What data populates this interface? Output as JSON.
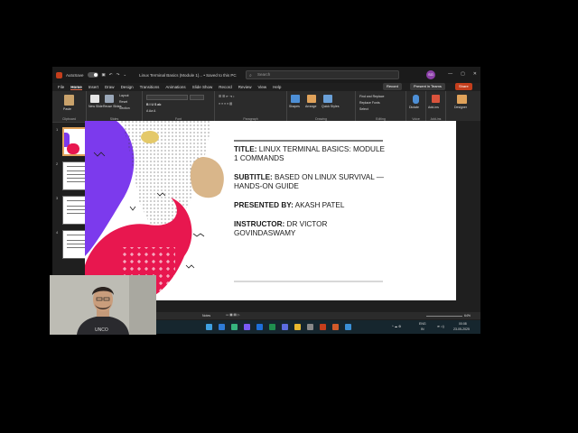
{
  "titlebar": {
    "autosave_label": "AutoSave",
    "autosave_state": "Off",
    "doc_title": "Linux Terminal Basics (Module 1)... • Saved to this PC",
    "search_placeholder": "Search",
    "user_initials": "SG",
    "controls": [
      "—",
      "▢",
      "✕"
    ]
  },
  "menu": {
    "tabs": [
      "File",
      "Home",
      "Insert",
      "Draw",
      "Design",
      "Transitions",
      "Animations",
      "Slide Show",
      "Record",
      "Review",
      "View",
      "Help"
    ],
    "active": "Home",
    "record_label": "Record",
    "teams_label": "Present in Teams",
    "share_label": "Share"
  },
  "ribbon": {
    "clipboard": {
      "paste": "Paste",
      "group": "Clipboard"
    },
    "slides": {
      "new_slide": "New Slide",
      "reuse": "Reuse Slides",
      "layout": "Layout",
      "reset": "Reset",
      "section": "Section",
      "group": "Slides"
    },
    "font": {
      "group": "Font"
    },
    "paragraph": {
      "group": "Paragraph"
    },
    "drawing": {
      "shapes": "Shapes",
      "arrange": "Arrange",
      "quick_styles": "Quick Styles",
      "group": "Drawing"
    },
    "editing": {
      "find": "Find and Replace",
      "replace": "Replace Fonts",
      "select": "Select",
      "group": "Editing"
    },
    "voice": {
      "dictate": "Dictate",
      "group": "Voice"
    },
    "addins": {
      "addins": "Add-ins",
      "group": "Add-ins"
    },
    "designer": {
      "label": "Designer"
    }
  },
  "thumbnails": [
    "1",
    "2",
    "3",
    "4"
  ],
  "slide": {
    "title_label": "TITLE:",
    "title_text": "LINUX TERMINAL BASICS: MODULE 1 COMMANDS",
    "subtitle_label": "SUBTITLE:",
    "subtitle_text": "BASED ON LINUX SURVIVAL — HANDS-ON GUIDE",
    "presented_label": "PRESENTED BY:",
    "presented_text": "AKASH PATEL",
    "instructor_label": "INSTRUCTOR:",
    "instructor_text": "DR VICTOR GOVINDASWAMY"
  },
  "statusbar": {
    "notes": "Notes",
    "zoom": "64%"
  },
  "taskbar": {
    "lang": "ENG",
    "lang2": "IN",
    "time": "00:08",
    "date": "23-05-2025"
  },
  "colors": {
    "accent": "#c43e1c",
    "purple": "#7c3aed",
    "magenta": "#e8174f",
    "gold": "#e4c96a",
    "tan": "#d9b68a"
  }
}
